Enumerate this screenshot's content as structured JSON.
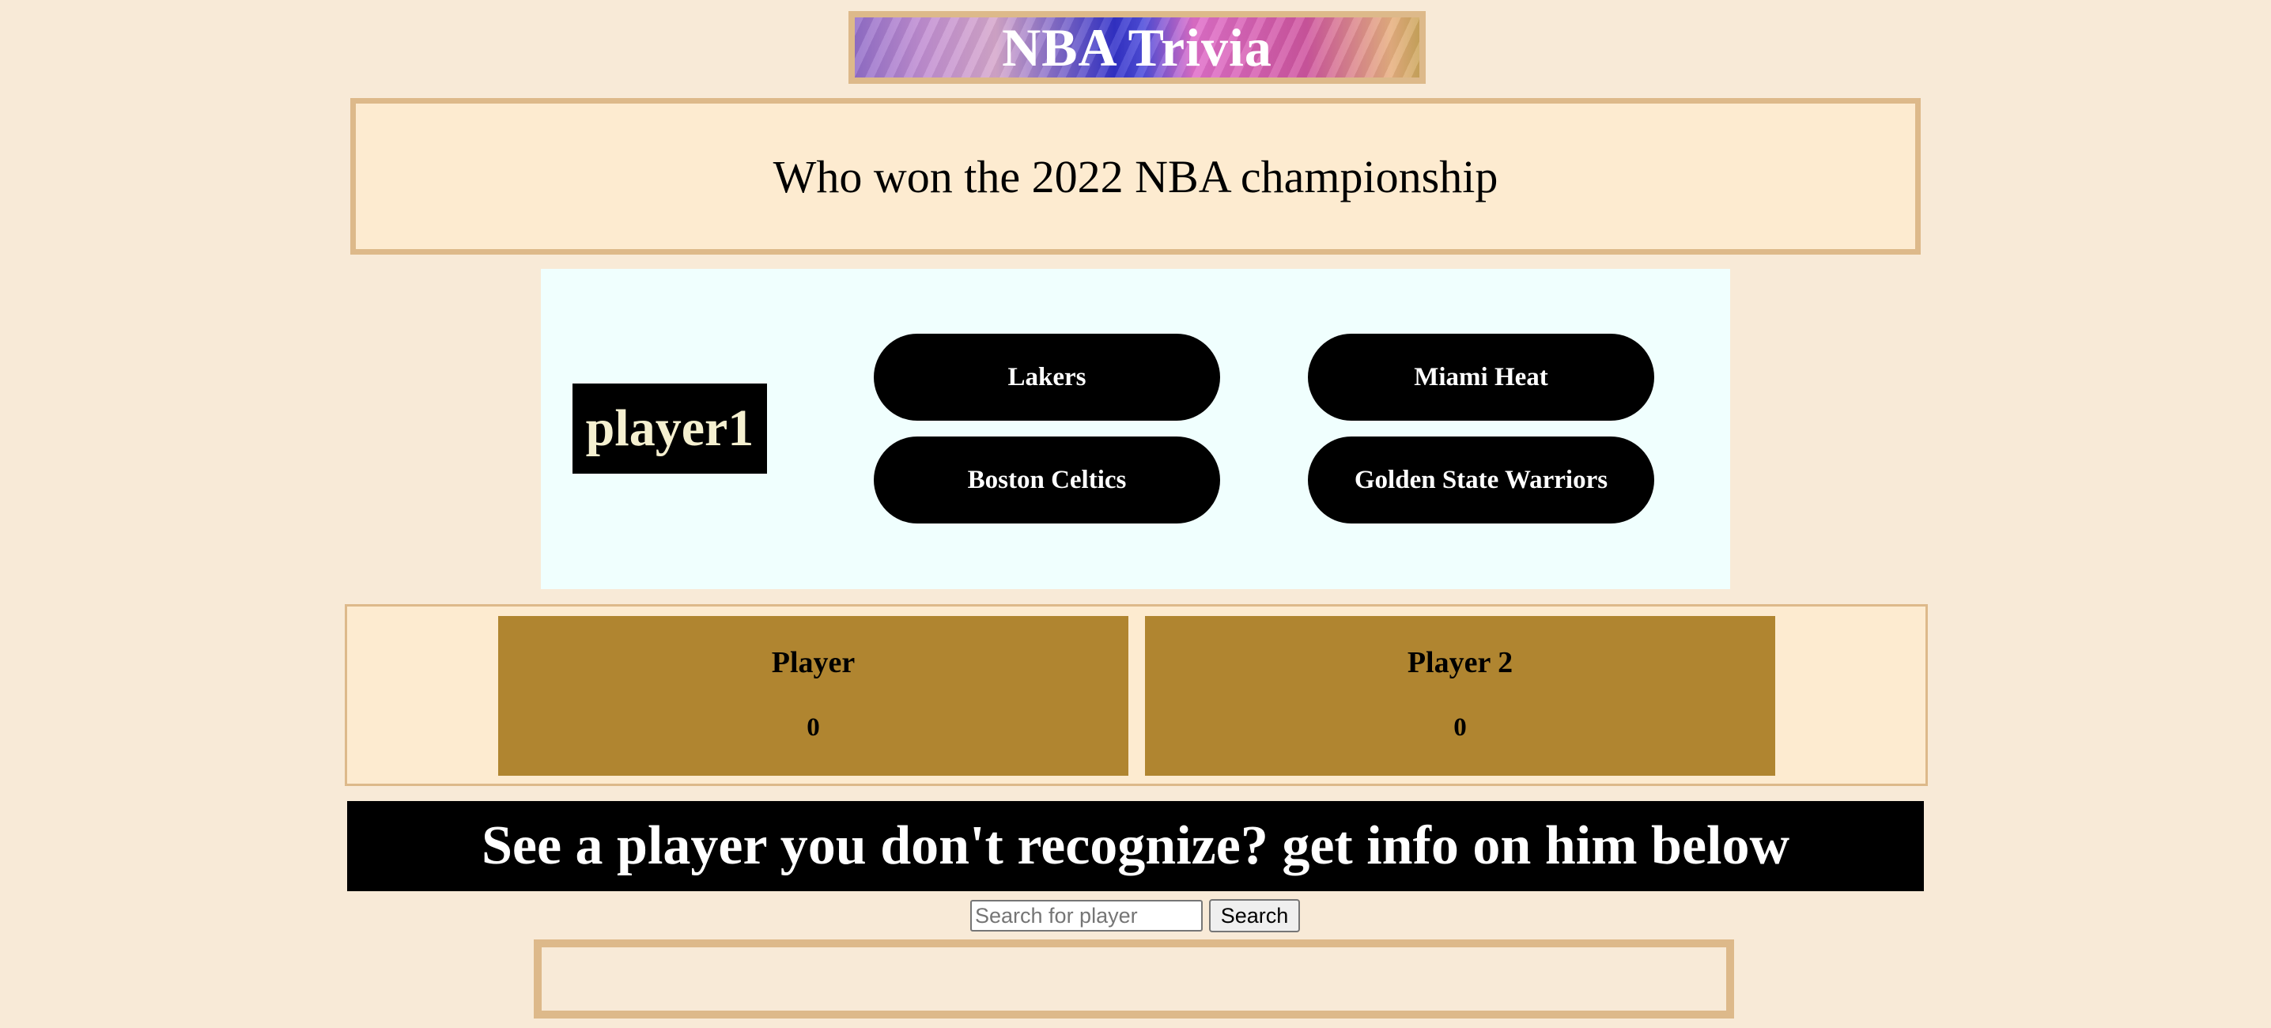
{
  "header": {
    "title": "NBA Trivia"
  },
  "question": {
    "text": "Who won the 2022 NBA championship"
  },
  "game": {
    "current_player": "player1",
    "answers": [
      "Lakers",
      "Miami Heat",
      "Boston Celtics",
      "Golden State Warriors"
    ]
  },
  "scoreboard": {
    "players": [
      {
        "name": "Player",
        "score": "0"
      },
      {
        "name": "Player 2",
        "score": "0"
      }
    ]
  },
  "info": {
    "banner": "See a player you don't recognize? get info on him below"
  },
  "search": {
    "placeholder": "Search for player",
    "button_label": "Search"
  },
  "colors": {
    "page_bg": "#f8ead7",
    "border": "#ddb98a",
    "question_bg": "#fdebd0",
    "panel_bg": "#f0fffe",
    "score_card": "#b08530",
    "button": "#000000"
  }
}
